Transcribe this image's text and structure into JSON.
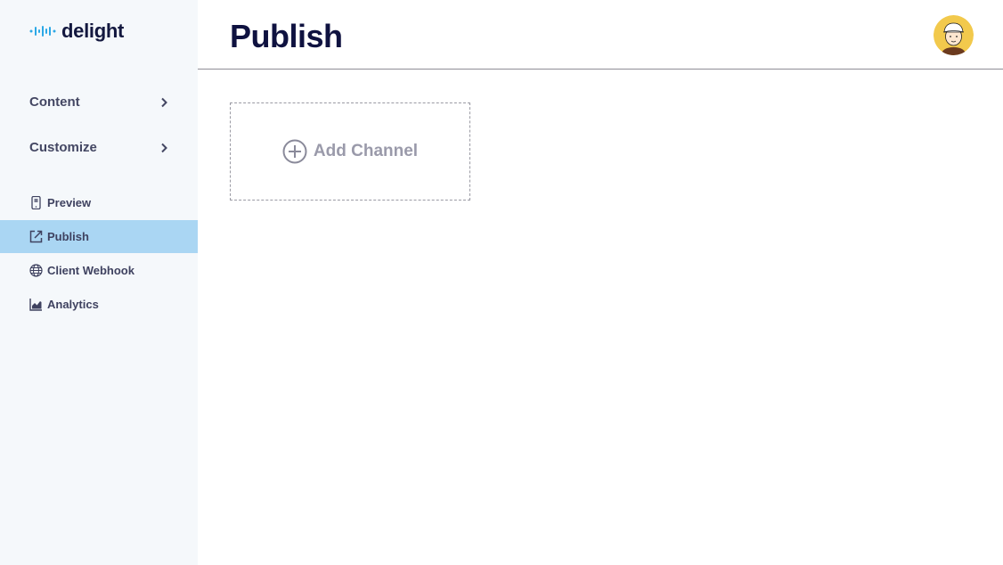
{
  "brand": {
    "name": "delight"
  },
  "sidebar": {
    "groups": [
      {
        "label": "Content",
        "icon": "chevron-right-icon"
      },
      {
        "label": "Customize",
        "icon": "chevron-right-icon"
      }
    ],
    "items": [
      {
        "label": "Preview",
        "icon": "mobile-preview-icon",
        "active": false
      },
      {
        "label": "Publish",
        "icon": "external-link-icon",
        "active": true
      },
      {
        "label": "Client Webhook",
        "icon": "globe-icon",
        "active": false
      },
      {
        "label": "Analytics",
        "icon": "area-chart-icon",
        "active": false
      }
    ]
  },
  "header": {
    "title": "Publish",
    "avatar": "user-avatar"
  },
  "main": {
    "add_channel_label": "Add Channel",
    "add_channel_icon": "plus-circle-icon"
  },
  "colors": {
    "sidebar_bg": "#f5f8fb",
    "active_item_bg": "#aad6f3",
    "title": "#0f1240",
    "accent_logo": "#2ba8e6"
  }
}
